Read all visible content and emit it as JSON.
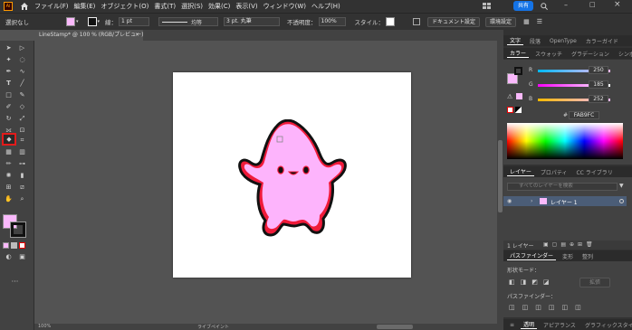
{
  "menubar": {
    "logo": "Ai",
    "items": [
      "ファイル(F)",
      "編集(E)",
      "オブジェクト(O)",
      "書式(T)",
      "選択(S)",
      "効果(C)",
      "表示(V)",
      "ウィンドウ(W)",
      "ヘルプ(H)"
    ],
    "share": "共有"
  },
  "controlbar": {
    "selection": "選択なし",
    "stroke_label": "線：",
    "stroke_weight": "1 pt",
    "line_profile": "均等",
    "brush": "3 pt. 丸筆",
    "opacity_label": "不透明度：",
    "opacity": "100%",
    "style_label": "スタイル：",
    "doc_settings": "ドキュメント設定",
    "preferences": "環境設定"
  },
  "document": {
    "tab_title": "LineStamp* @ 100 % (RGB/プレビュー)",
    "close": "×"
  },
  "status_bar": {
    "zoom": "100%",
    "tool": "ライブペイント"
  },
  "panels": {
    "top_tabs": [
      "文字",
      "段落",
      "OpenType",
      "カラーガイド"
    ],
    "color_tabs": [
      "カラー",
      "スウォッチ",
      "グラデーション",
      "シンボル"
    ],
    "color": {
      "r_label": "R",
      "r": "250",
      "g_label": "G",
      "g": "185",
      "b_label": "B",
      "b": "252",
      "hex_label": "#",
      "hex": "FAB9FC",
      "swatch_color": "#fab9fc"
    },
    "layers_tabs": [
      "レイヤー",
      "プロパティ",
      "CC ライブラリ"
    ],
    "layers_search_placeholder": "すべてのレイヤーを検索",
    "layer_name": "レイヤー 1",
    "layers_count": "1 レイヤー",
    "pathfinder_tabs": [
      "パスファインダー",
      "変形",
      "整列"
    ],
    "shape_mode": "形状モード：",
    "expand_button": "拡張",
    "pathfinder_label": "パスファインダー：",
    "bottom_tabs": [
      "透明",
      "アピアランス",
      "グラフィックスタイル"
    ]
  },
  "colors": {
    "fill": "#fab9fc",
    "accent_blue": "#1473e6",
    "character_fill": "#fdb4fc",
    "character_stroke": "#f01b3a"
  }
}
